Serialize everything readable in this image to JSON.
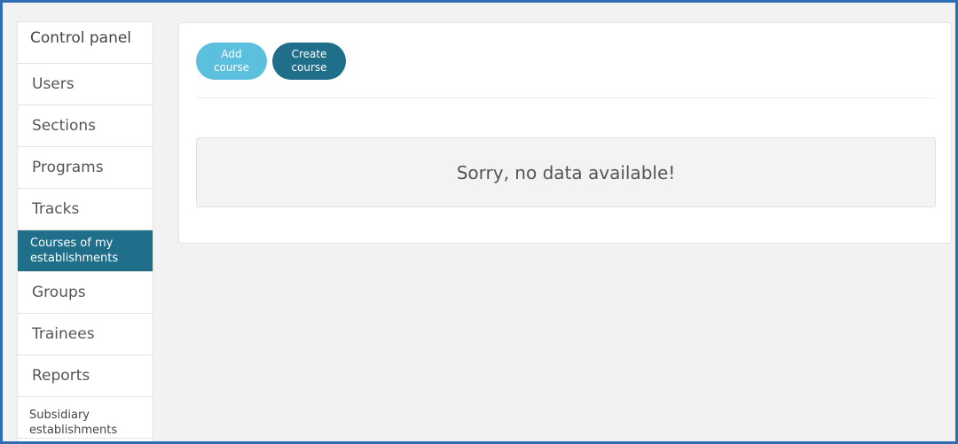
{
  "sidebar": {
    "title": "Control panel",
    "items": [
      {
        "label": "Users"
      },
      {
        "label": "Sections"
      },
      {
        "label": "Programs"
      },
      {
        "label": "Tracks"
      },
      {
        "label": "Courses of my establishments",
        "active": true
      },
      {
        "label": "Groups"
      },
      {
        "label": "Trainees"
      },
      {
        "label": "Reports"
      },
      {
        "label": "Subsidiary establishments"
      }
    ]
  },
  "toolbar": {
    "add_course_label": "Add course",
    "create_course_line1": "Create",
    "create_course_line2": "course"
  },
  "main": {
    "empty_message": "Sorry, no data available!"
  },
  "colors": {
    "frame_border": "#2e6db4",
    "active_item": "#1f6f8b",
    "add_button": "#5bc0de",
    "create_button": "#1f6f8b",
    "page_background": "#f2f2f2"
  }
}
